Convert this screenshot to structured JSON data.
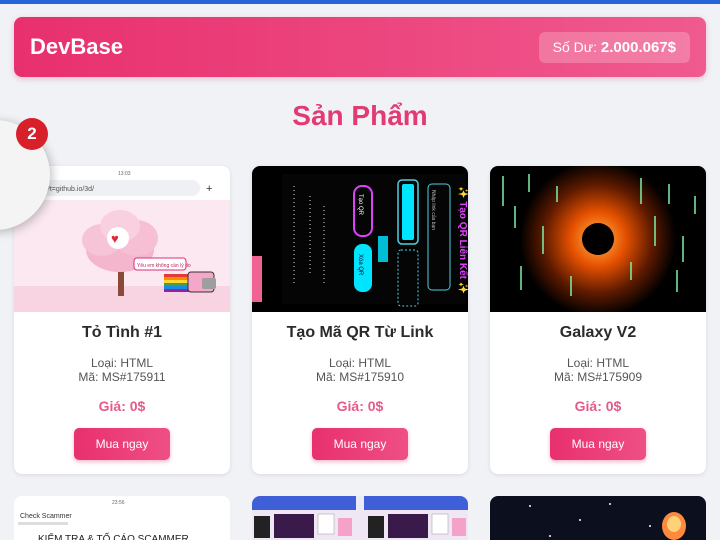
{
  "header": {
    "logo": "DevBase",
    "balance_label": "Số Dư:",
    "balance_value": "2.000.067$"
  },
  "page_title": "Sản Phẩm",
  "notification_count": "2",
  "products": [
    {
      "name": "Tỏ Tình #1",
      "type": "Loại: HTML",
      "code": "Mã: MS#175911",
      "price": "Giá: 0$",
      "button": "Mua ngay",
      "thumb_status_time": "13:03",
      "thumb_url": "/?t=github.io/3d/",
      "thumb_bubble": "Yêu em không cần lý do"
    },
    {
      "name": "Tạo Mã QR Từ Link",
      "type": "Loại: HTML",
      "code": "Mã: MS#175910",
      "price": "Giá: 0$",
      "button": "Mua ngay",
      "thumb_heading": "✨ Tạo QR Liên Kết ✨",
      "thumb_btn1": "Tạo QR",
      "thumb_btn2": "Xóa QR",
      "thumb_field": "Nhập link của bạn"
    },
    {
      "name": "Galaxy V2",
      "type": "Loại: HTML",
      "code": "Mã: MS#175909",
      "price": "Giá: 0$",
      "button": "Mua ngay"
    }
  ],
  "second_row": {
    "card1_time": "23:56",
    "card1_subtitle": "Check Scammer",
    "card1_heading": "KIỂM TRA & TỐ CÁO SCAMMER"
  },
  "colors": {
    "accent": "#e8306e",
    "price": "#e65a8a",
    "badge": "#d8202b"
  }
}
